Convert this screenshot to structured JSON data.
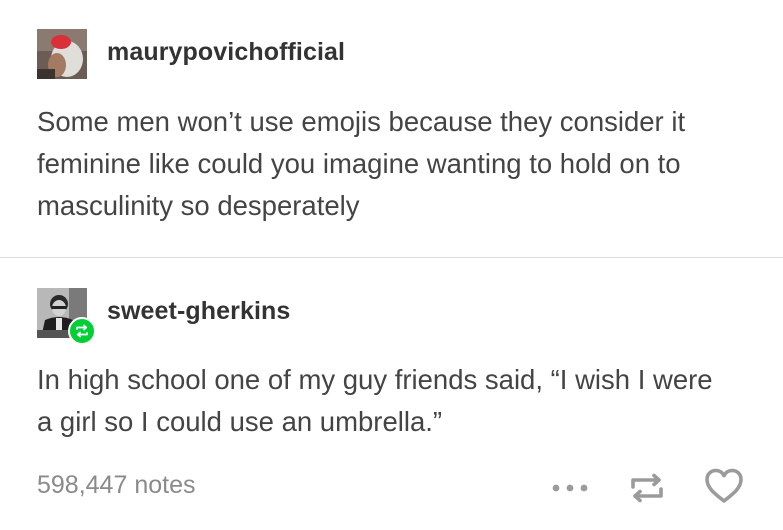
{
  "posts": [
    {
      "username": "maurypovichofficial",
      "avatar": "profile-photo",
      "lines": [
        "Some men won’t use emojis because they consider it",
        "feminine like could you imagine wanting to hold on to",
        "masculinity so desperately"
      ]
    },
    {
      "username": "sweet-gherkins",
      "avatar": "profile-photo-bw",
      "badge": "reblog-icon",
      "lines": [
        "In high school one of my guy friends said, “I wish I were",
        "a girl so I could use an umbrella.”"
      ]
    }
  ],
  "footer": {
    "notes": "598,447 notes",
    "actions": [
      "more-icon",
      "reblog-icon",
      "heart-icon"
    ]
  },
  "colors": {
    "text": "#444444",
    "username": "#333333",
    "notes": "#8a8a8a",
    "divider": "#dcdcdc",
    "reblog_badge": "#00cf35",
    "icon": "#9b9b9b"
  }
}
